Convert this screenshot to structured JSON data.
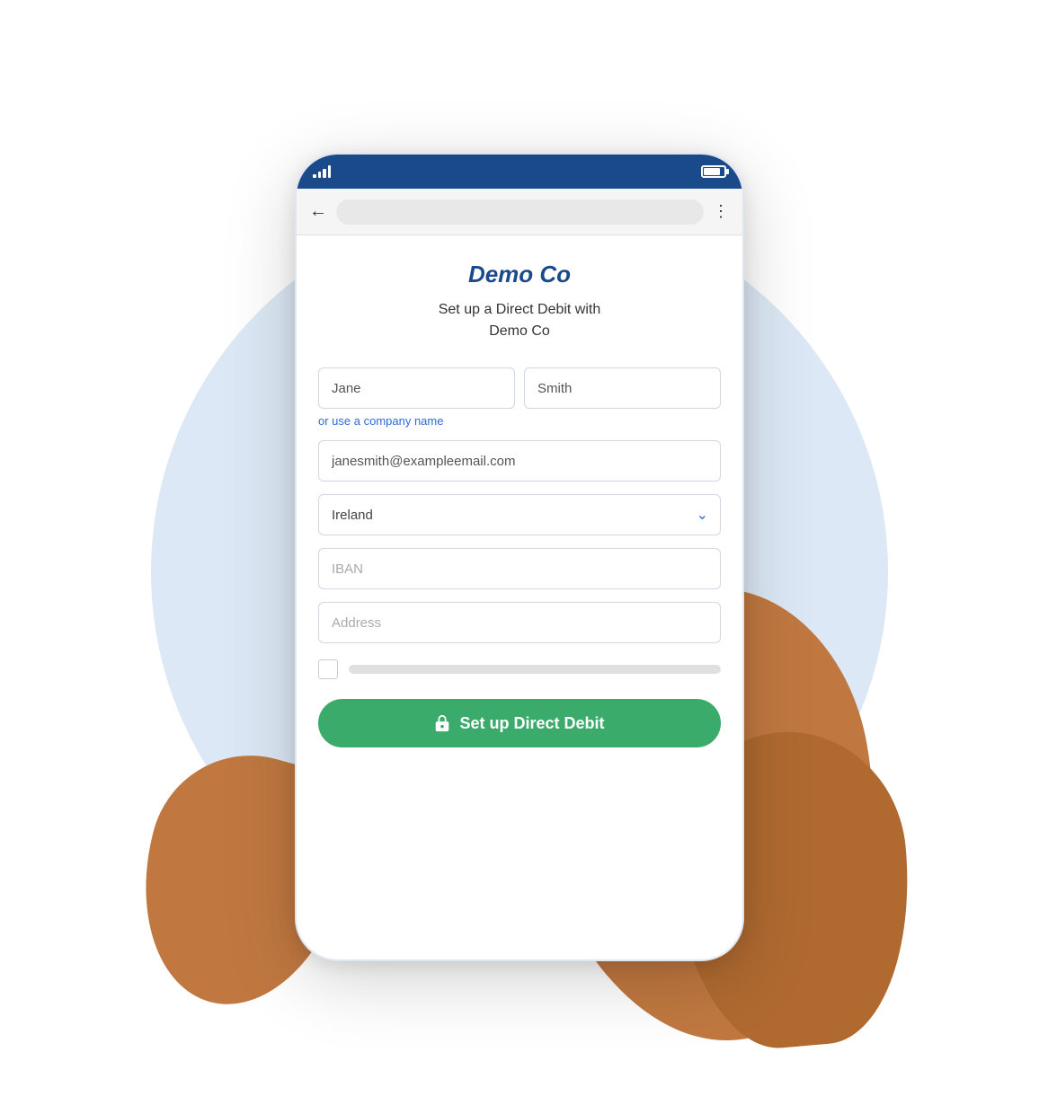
{
  "background": {
    "circle_color": "#dce8f5"
  },
  "status_bar": {
    "background": "#1a4a8a"
  },
  "browser_bar": {
    "back_label": "←",
    "menu_label": "⋮"
  },
  "page": {
    "company_name": "Demo Co",
    "subtitle_line1": "Set up a Direct Debit with",
    "subtitle_line2": "Demo Co",
    "company_link_label": "or use a company name",
    "first_name_value": "Jane",
    "last_name_value": "Smith",
    "email_value": "janesmith@exampleemail.com",
    "country_value": "Ireland",
    "iban_placeholder": "IBAN",
    "address_placeholder": "Address",
    "submit_label": "Set up Direct Debit"
  }
}
